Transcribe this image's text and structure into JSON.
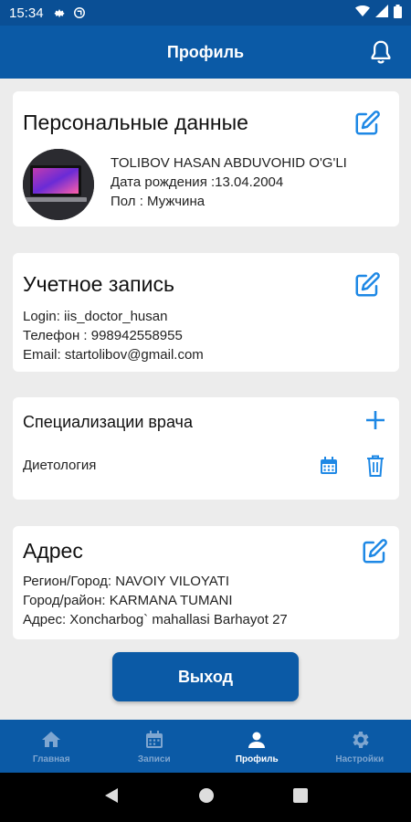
{
  "status_bar": {
    "time": "15:34"
  },
  "app_bar": {
    "title": "Профиль"
  },
  "personal": {
    "heading": "Персональные данные",
    "name": "TOLIBOV HASAN ABDUVOHID O'G'LI",
    "birth": "Дата рождения :13.04.2004",
    "gender": "Пол : Мужчина"
  },
  "account": {
    "heading": "Учетное запись",
    "login": "Login: iis_doctor_husan",
    "phone": "Телефон : 998942558955",
    "email": "Email: startolibov@gmail.com"
  },
  "specializations": {
    "heading": "Специализации врача",
    "items": [
      {
        "name": "Диетология"
      }
    ]
  },
  "address": {
    "heading": "Адрес",
    "region": "Регион/Город: NAVOIY VILOYATI",
    "district": "Город/район: KARMANA TUMANI",
    "street": "Адрес: Xoncharbog` mahallasi Barhayot 27"
  },
  "logout_label": "Выход",
  "bottom_nav": [
    {
      "label": "Главная",
      "icon": "home-icon"
    },
    {
      "label": "Записи",
      "icon": "calendar-icon"
    },
    {
      "label": "Профиль",
      "icon": "person-icon",
      "active": true
    },
    {
      "label": "Настройки",
      "icon": "gear-icon"
    }
  ],
  "colors": {
    "primary": "#0b5aa6",
    "status_bar": "#0a4f95",
    "accent_blue": "#1e88e5",
    "background": "#ececec"
  }
}
